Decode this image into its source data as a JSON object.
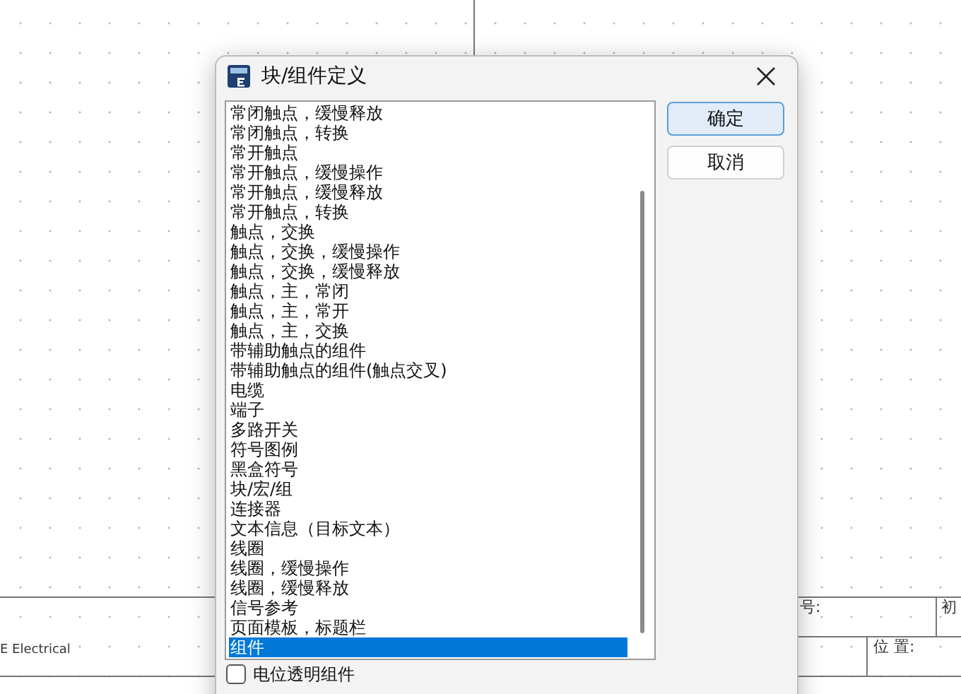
{
  "canvas": {
    "title_block_texts": [
      {
        "kind": "left",
        "text": "E Electrical"
      },
      {
        "kind": "number",
        "text": "号:"
      },
      {
        "kind": "first",
        "text": "初"
      },
      {
        "kind": "position",
        "text": "位 置:"
      }
    ]
  },
  "dialog": {
    "title": "块/组件定义",
    "items": [
      {
        "label": "常闭触点，缓慢释放",
        "selected": false
      },
      {
        "label": "常闭触点，转换",
        "selected": false
      },
      {
        "label": "常开触点",
        "selected": false
      },
      {
        "label": "常开触点，缓慢操作",
        "selected": false
      },
      {
        "label": "常开触点，缓慢释放",
        "selected": false
      },
      {
        "label": "常开触点，转换",
        "selected": false
      },
      {
        "label": "触点，交换",
        "selected": false
      },
      {
        "label": "触点，交换，缓慢操作",
        "selected": false
      },
      {
        "label": "触点，交换，缓慢释放",
        "selected": false
      },
      {
        "label": "触点，主，常闭",
        "selected": false
      },
      {
        "label": "触点，主，常开",
        "selected": false
      },
      {
        "label": "触点，主，交换",
        "selected": false
      },
      {
        "label": "带辅助触点的组件",
        "selected": false
      },
      {
        "label": "带辅助触点的组件(触点交叉)",
        "selected": false
      },
      {
        "label": "电缆",
        "selected": false
      },
      {
        "label": "端子",
        "selected": false
      },
      {
        "label": "多路开关",
        "selected": false
      },
      {
        "label": "符号图例",
        "selected": false
      },
      {
        "label": "黑盒符号",
        "selected": false
      },
      {
        "label": "块/宏/组",
        "selected": false
      },
      {
        "label": "连接器",
        "selected": false
      },
      {
        "label": "文本信息（目标文本）",
        "selected": false
      },
      {
        "label": "线圈",
        "selected": false
      },
      {
        "label": "线圈，缓慢操作",
        "selected": false
      },
      {
        "label": "线圈，缓慢释放",
        "selected": false
      },
      {
        "label": "信号参考",
        "selected": false
      },
      {
        "label": "页面模板，标题栏",
        "selected": false
      },
      {
        "label": "组件",
        "selected": true
      }
    ],
    "buttons": [
      {
        "label": "确定",
        "default": true
      },
      {
        "label": "取消",
        "default": false
      }
    ],
    "checkbox": {
      "label": "电位透明组件",
      "checked": false
    }
  }
}
